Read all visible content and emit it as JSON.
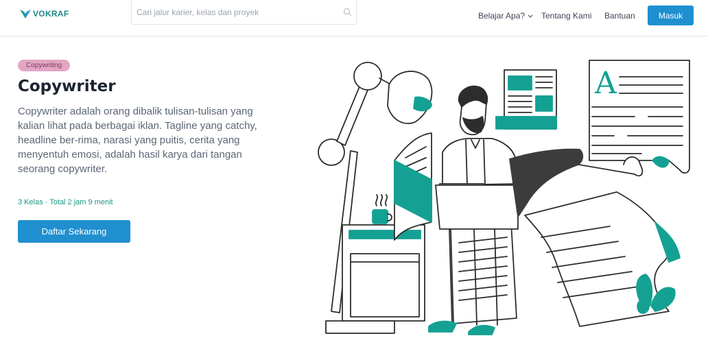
{
  "header": {
    "logo_text": "VOKRAF",
    "search_placeholder": "Cari jalur karier, kelas dan proyek",
    "nav": {
      "learn_label": "Belajar Apa?",
      "about_label": "Tentang Kami",
      "help_label": "Bantuan"
    },
    "login_label": "Masuk"
  },
  "hero": {
    "tag": "Copywriting",
    "title": "Copywriter",
    "description": "Copywriter adalah orang dibalik tulisan-tulisan yang kalian lihat pada berbagai iklan. Tagline yang catchy, headline ber-rima, narasi yang puitis, cerita yang menyentuh emosi, adalah hasil karya dari tangan seorang copywriter.",
    "meta": "3 Kelas · Total 2 jam 9 menit",
    "cta_label": "Daftar Sekarang",
    "illustration_letter": "A"
  },
  "icons": {
    "logo": "vokraf-logo-icon",
    "search": "search-icon",
    "dropdown": "chevron-down-icon"
  },
  "colors": {
    "primary": "#1f8fcf",
    "teal": "#14a193",
    "tag_bg": "#e2a6c4",
    "meta_text": "#179683",
    "dark_text": "#1c2330",
    "ink": "#2d2d2d"
  }
}
